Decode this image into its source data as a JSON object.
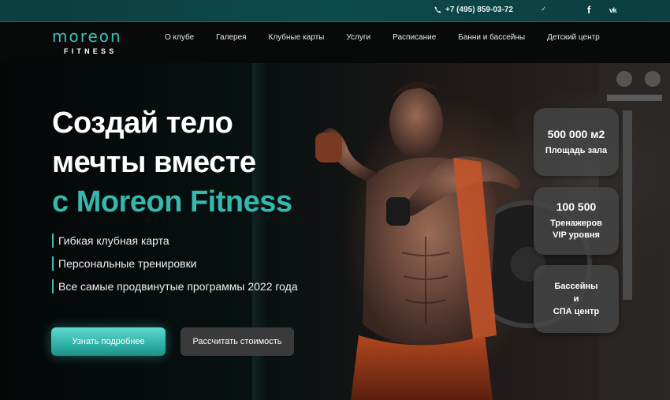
{
  "topbar": {
    "phone": "+7 (495) 859-03-72",
    "icons": [
      "phone-icon",
      "telegram-icon",
      "facebook-icon",
      "vk-icon"
    ]
  },
  "logo": {
    "top": "moreon",
    "bottom": "FITNESS"
  },
  "nav": {
    "items": [
      {
        "label": "О клубе"
      },
      {
        "label": "Галерея"
      },
      {
        "label": "Клубные карты"
      },
      {
        "label": "Услуги"
      },
      {
        "label": "Расписание"
      },
      {
        "label": "Банни и бассейны"
      },
      {
        "label": "Детский центр"
      }
    ]
  },
  "hero": {
    "title_line1": "Создай тело",
    "title_line2": "мечты вместе",
    "title_line3": "с Moreon Fitness",
    "features": [
      {
        "text": "Гибкая клубная карта"
      },
      {
        "text": "Персональные тренировки"
      },
      {
        "text": "Все самые продвинутые программы 2022 года"
      }
    ],
    "primary_button": "Узнать подробнее",
    "secondary_button": "Рассчитать стоимость"
  },
  "stats": [
    {
      "value": "500 000 м2",
      "label": "Площадь зала"
    },
    {
      "value": "100 500",
      "label": "Тренажеров\nVIP уровня"
    },
    {
      "value": "",
      "label": "Бассейны\nи\nСПА центр"
    }
  ],
  "colors": {
    "accent": "#3cc2b7",
    "topbar": "#0d4a4c",
    "nav": "#080a0a"
  }
}
